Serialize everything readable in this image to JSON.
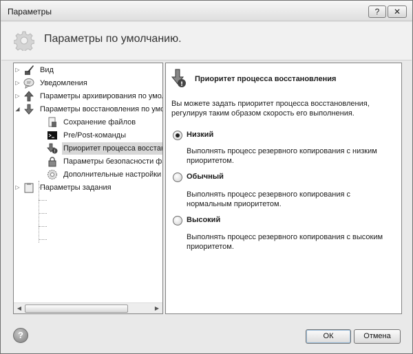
{
  "window": {
    "title": "Параметры",
    "help_glyph": "?",
    "close_glyph": "✕"
  },
  "header": {
    "title": "Параметры по умолчанию."
  },
  "tree": {
    "items": [
      {
        "label": "Вид",
        "icon": "paint-brush-icon",
        "expander": "▷"
      },
      {
        "label": "Уведомления",
        "icon": "speech-bubble-icon",
        "expander": "▷"
      },
      {
        "label": "Параметры архивирования по умол",
        "icon": "upload-arrow-icon",
        "expander": "▷"
      },
      {
        "label": "Параметры восстановления по умо",
        "icon": "download-arrow-icon",
        "expander": "◢"
      },
      {
        "label": "Сохранение файлов",
        "icon": "file-save-icon"
      },
      {
        "label": "Pre/Post-команды",
        "icon": "command-prompt-icon"
      },
      {
        "label": "Приоритет процесса восстанов.",
        "icon": "priority-icon",
        "selected": true
      },
      {
        "label": "Параметры безопасности файло",
        "icon": "lock-icon"
      },
      {
        "label": "Дополнительные настройки",
        "icon": "gear-icon"
      },
      {
        "label": "Параметры задания",
        "icon": "clipboard-icon",
        "expander": "▷"
      }
    ]
  },
  "detail": {
    "title": "Приоритет процесса восстановления",
    "description": "Вы можете задать приоритет процесса восстановления, регулируя таким образом скорость его выполнения.",
    "options": [
      {
        "label": "Низкий",
        "description": "Выполнять процесс резервного копирования с низким приоритетом.",
        "selected": true
      },
      {
        "label": "Обычный",
        "description": "Выполнять процесс резервного копирования с нормальным приоритетом.",
        "selected": false
      },
      {
        "label": "Высокий",
        "description": "Выполнять процесс резервного копирования с высоким приоритетом.",
        "selected": false
      }
    ]
  },
  "footer": {
    "help_glyph": "?",
    "ok_label": "ОК",
    "cancel_label": "Отмена"
  }
}
